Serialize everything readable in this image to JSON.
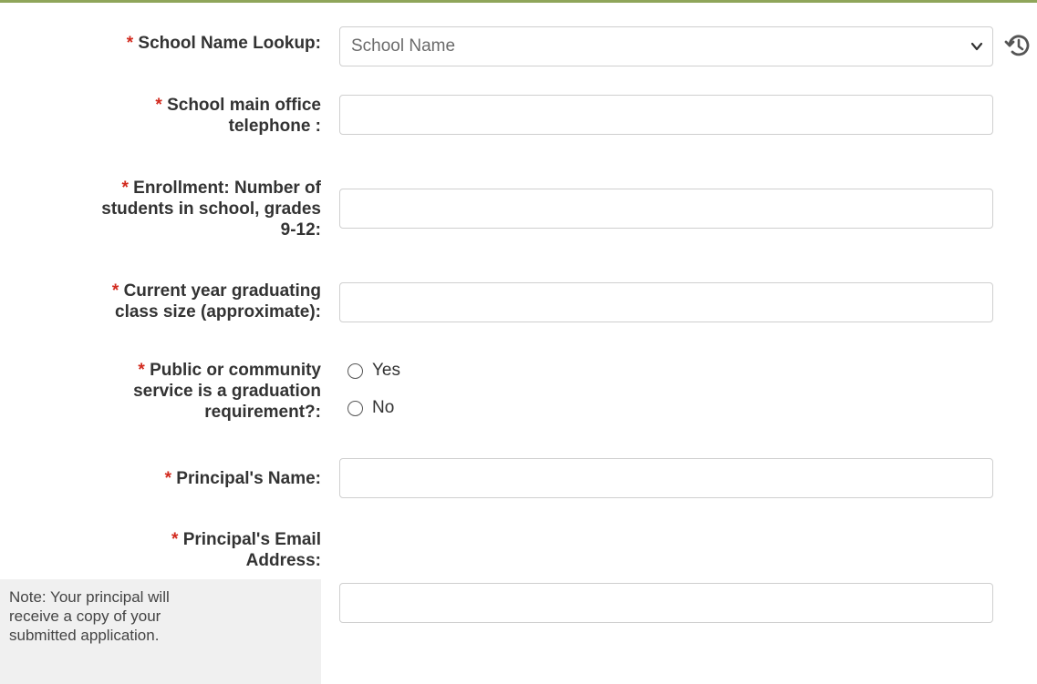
{
  "form": {
    "required_marker": "*",
    "school_lookup": {
      "label": "School Name Lookup:",
      "placeholder": "School Name",
      "value": ""
    },
    "telephone": {
      "label_line1": "School main office",
      "label_line2": "telephone :",
      "value": ""
    },
    "enrollment": {
      "label_line1": "Enrollment: Number of",
      "label_line2": "students in school, grades",
      "label_line3": "9-12:",
      "value": ""
    },
    "graduating": {
      "label_line1": "Current year graduating",
      "label_line2": "class size (approximate):",
      "value": ""
    },
    "service": {
      "label_line1": "Public or community",
      "label_line2": "service is a graduation",
      "label_line3": "requirement?:",
      "options": [
        "Yes",
        "No"
      ],
      "selected": null
    },
    "principal_name": {
      "label": "Principal's Name:",
      "value": ""
    },
    "principal_email": {
      "label_line1": "Principal's Email",
      "label_line2": "Address:",
      "value": "",
      "note_line1": "Note: Your principal will",
      "note_line2": "receive a copy of your",
      "note_line3": "submitted application."
    }
  },
  "colors": {
    "accent_line": "#8fa55a",
    "required": "#d22a1e",
    "label_text": "#333333",
    "input_border": "#cfcfcf",
    "note_background": "#f0f0f0"
  },
  "icons": {
    "dropdown": "chevron-down-icon",
    "history": "history-icon"
  }
}
